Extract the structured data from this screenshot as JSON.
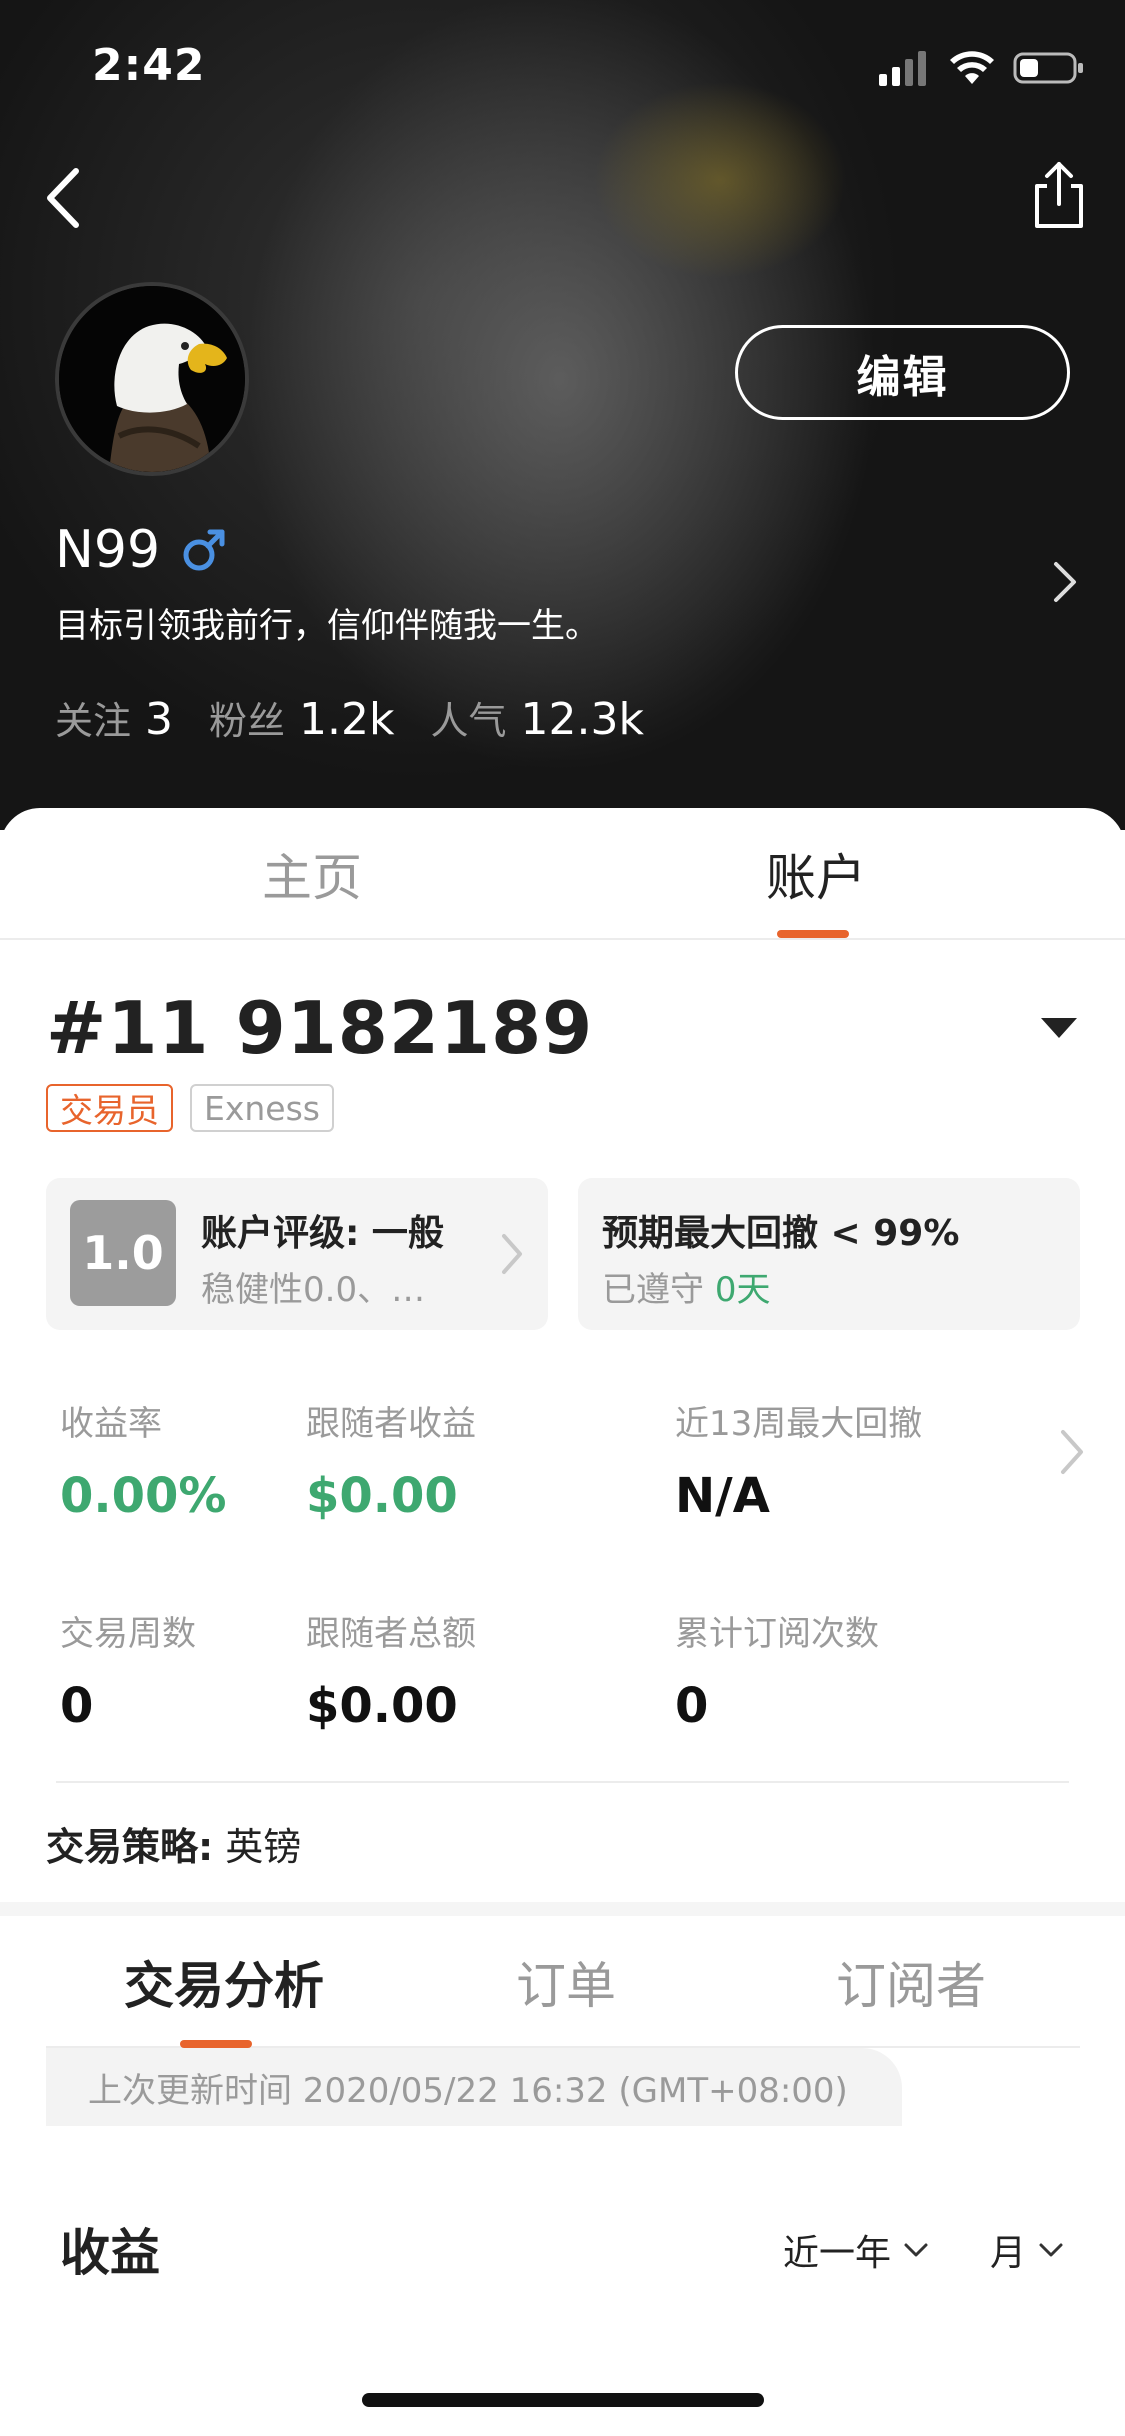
{
  "status_bar": {
    "time": "2:42"
  },
  "header": {
    "edit_label": "编辑",
    "username": "N99",
    "bio": "目标引领我前行，信仰伴随我一生。",
    "stats": [
      {
        "label": "关注",
        "value": "3"
      },
      {
        "label": "粉丝",
        "value": "1.2k"
      },
      {
        "label": "人气",
        "value": "12.3k"
      }
    ],
    "icons": [
      "back-icon",
      "share-icon",
      "male-gender-icon",
      "chevron-right-icon"
    ],
    "gender_color": "#4a90e2"
  },
  "top_tabs": {
    "home": "主页",
    "account": "账户",
    "active": "account"
  },
  "account": {
    "number": "#11 9182189",
    "badges": {
      "role": "交易员",
      "broker": "Exness"
    },
    "rating_card": {
      "score": "1.0",
      "title": "账户评级: 一般",
      "subtitle": "稳健性0.0、…"
    },
    "drawdown_card": {
      "title": "预期最大回撤 < 99%",
      "status_label": "已遵守",
      "status_value": "0天"
    },
    "metrics": {
      "return_rate": {
        "label": "收益率",
        "value": "0.00%"
      },
      "follower_profit": {
        "label": "跟随者收益",
        "value": "$0.00"
      },
      "max_drawdown_13w": {
        "label": "近13周最大回撤",
        "value": "N/A"
      },
      "trading_weeks": {
        "label": "交易周数",
        "value": "0"
      },
      "follower_total": {
        "label": "跟随者总额",
        "value": "$0.00"
      },
      "subscription_count": {
        "label": "累计订阅次数",
        "value": "0"
      }
    },
    "strategy": {
      "label": "交易策略:",
      "value": "英镑"
    }
  },
  "sub_tabs": {
    "analysis": "交易分析",
    "orders": "订单",
    "subscribers": "订阅者",
    "active": "analysis"
  },
  "last_update": "上次更新时间 2020/05/22 16:32 (GMT+08:00)",
  "earnings": {
    "title": "收益",
    "range": "近一年",
    "period": "月"
  },
  "colors": {
    "accent": "#e8642c",
    "positive": "#3ea870"
  }
}
